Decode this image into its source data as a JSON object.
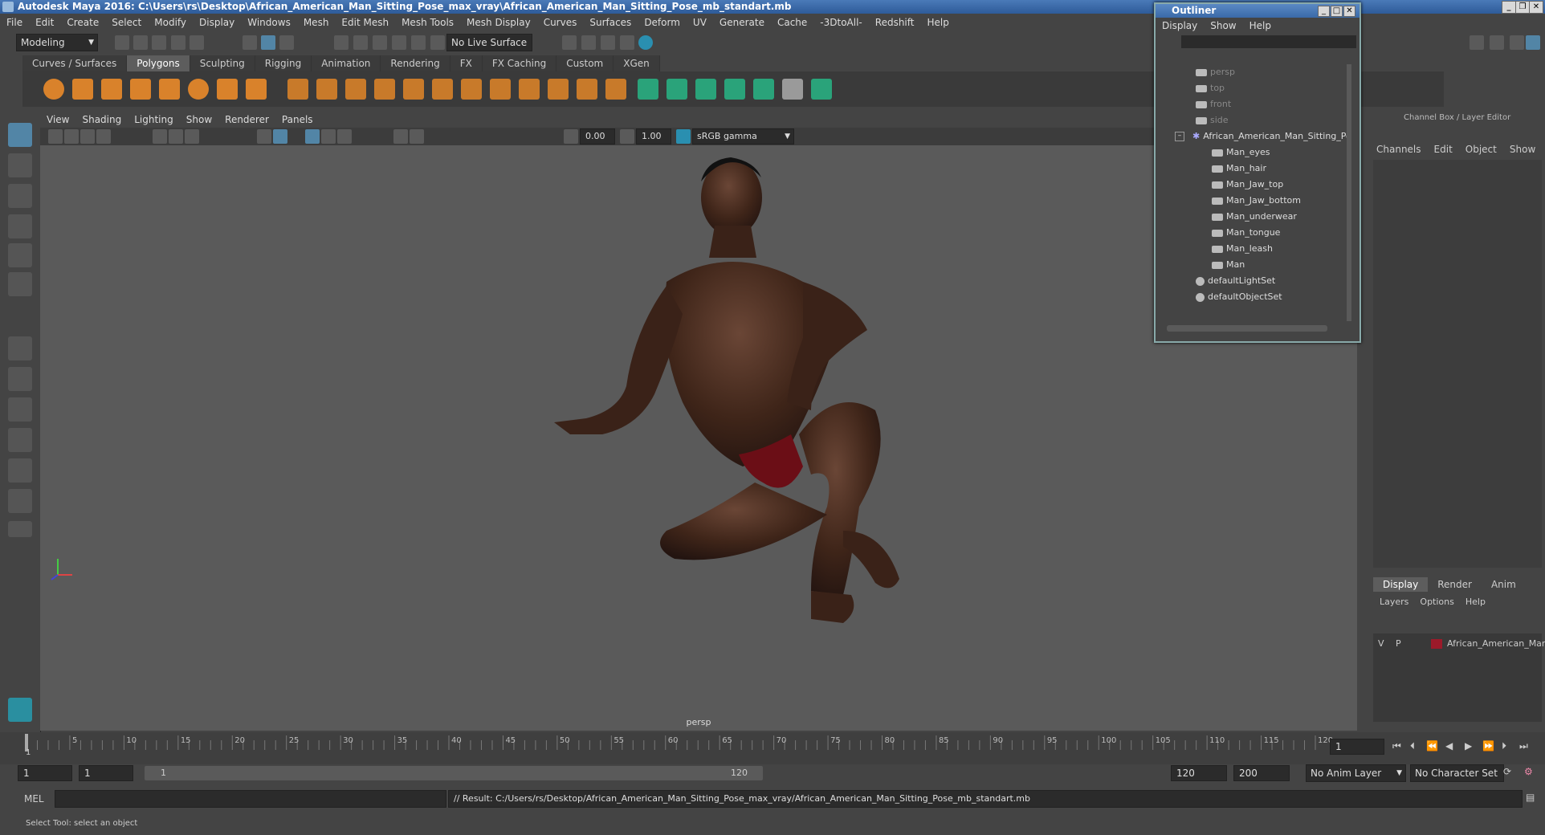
{
  "window": {
    "title": "Autodesk Maya 2016: C:\\Users\\rs\\Desktop\\African_American_Man_Sitting_Pose_max_vray\\African_American_Man_Sitting_Pose_mb_standart.mb"
  },
  "menubar": [
    "File",
    "Edit",
    "Create",
    "Select",
    "Modify",
    "Display",
    "Windows",
    "Mesh",
    "Edit Mesh",
    "Mesh Tools",
    "Mesh Display",
    "Curves",
    "Surfaces",
    "Deform",
    "UV",
    "Generate",
    "Cache",
    "-3DtoAll-",
    "Redshift",
    "Help"
  ],
  "status": {
    "mode": "Modeling",
    "live_surface": "No Live Surface"
  },
  "shelf_tabs": [
    "Curves / Surfaces",
    "Polygons",
    "Sculpting",
    "Rigging",
    "Animation",
    "Rendering",
    "FX",
    "FX Caching",
    "Custom",
    "XGen"
  ],
  "shelf_active": "Polygons",
  "viewport": {
    "menu": [
      "View",
      "Shading",
      "Lighting",
      "Show",
      "Renderer",
      "Panels"
    ],
    "exposure": "0.00",
    "gamma": "1.00",
    "color_space": "sRGB gamma",
    "camera_label": "persp"
  },
  "outliner": {
    "title": "Outliner",
    "menu": [
      "Display",
      "Show",
      "Help"
    ],
    "items": [
      {
        "label": "persp",
        "dim": true
      },
      {
        "label": "top",
        "dim": true
      },
      {
        "label": "front",
        "dim": true
      },
      {
        "label": "side",
        "dim": true
      },
      {
        "label": "African_American_Man_Sitting_Po",
        "dim": false
      },
      {
        "label": "Man_eyes",
        "dim": false
      },
      {
        "label": "Man_hair",
        "dim": false
      },
      {
        "label": "Man_Jaw_top",
        "dim": false
      },
      {
        "label": "Man_Jaw_bottom",
        "dim": false
      },
      {
        "label": "Man_underwear",
        "dim": false
      },
      {
        "label": "Man_tongue",
        "dim": false
      },
      {
        "label": "Man_leash",
        "dim": false
      },
      {
        "label": "Man",
        "dim": false
      },
      {
        "label": "defaultLightSet",
        "dim": false
      },
      {
        "label": "defaultObjectSet",
        "dim": false
      }
    ]
  },
  "channel_box": {
    "title": "Channel Box / Layer Editor",
    "menu": [
      "Channels",
      "Edit",
      "Object",
      "Show"
    ],
    "layer_tabs": [
      "Display",
      "Render",
      "Anim"
    ],
    "layer_menu": [
      "Layers",
      "Options",
      "Help"
    ],
    "layer": {
      "v": "V",
      "p": "P",
      "name": "African_American_Man",
      "color": "#9b1a2a"
    }
  },
  "timeline": {
    "ticks": [
      "5",
      "10",
      "15",
      "20",
      "25",
      "30",
      "35",
      "40",
      "45",
      "50",
      "55",
      "60",
      "65",
      "70",
      "75",
      "80",
      "85",
      "90",
      "95",
      "100",
      "105",
      "110",
      "115",
      "120"
    ],
    "start_marker": "1",
    "current_frame": "1"
  },
  "range": {
    "start": "1",
    "inner_start": "1",
    "slider_start": "1",
    "slider_end": "120",
    "end": "120",
    "max": "200",
    "anim_layer": "No Anim Layer",
    "char_set": "No Character Set"
  },
  "cmd": {
    "lang": "MEL",
    "result": "// Result: C:/Users/rs/Desktop/African_American_Man_Sitting_Pose_max_vray/African_American_Man_Sitting_Pose_mb_standart.mb"
  },
  "help": "Select Tool: select an object"
}
